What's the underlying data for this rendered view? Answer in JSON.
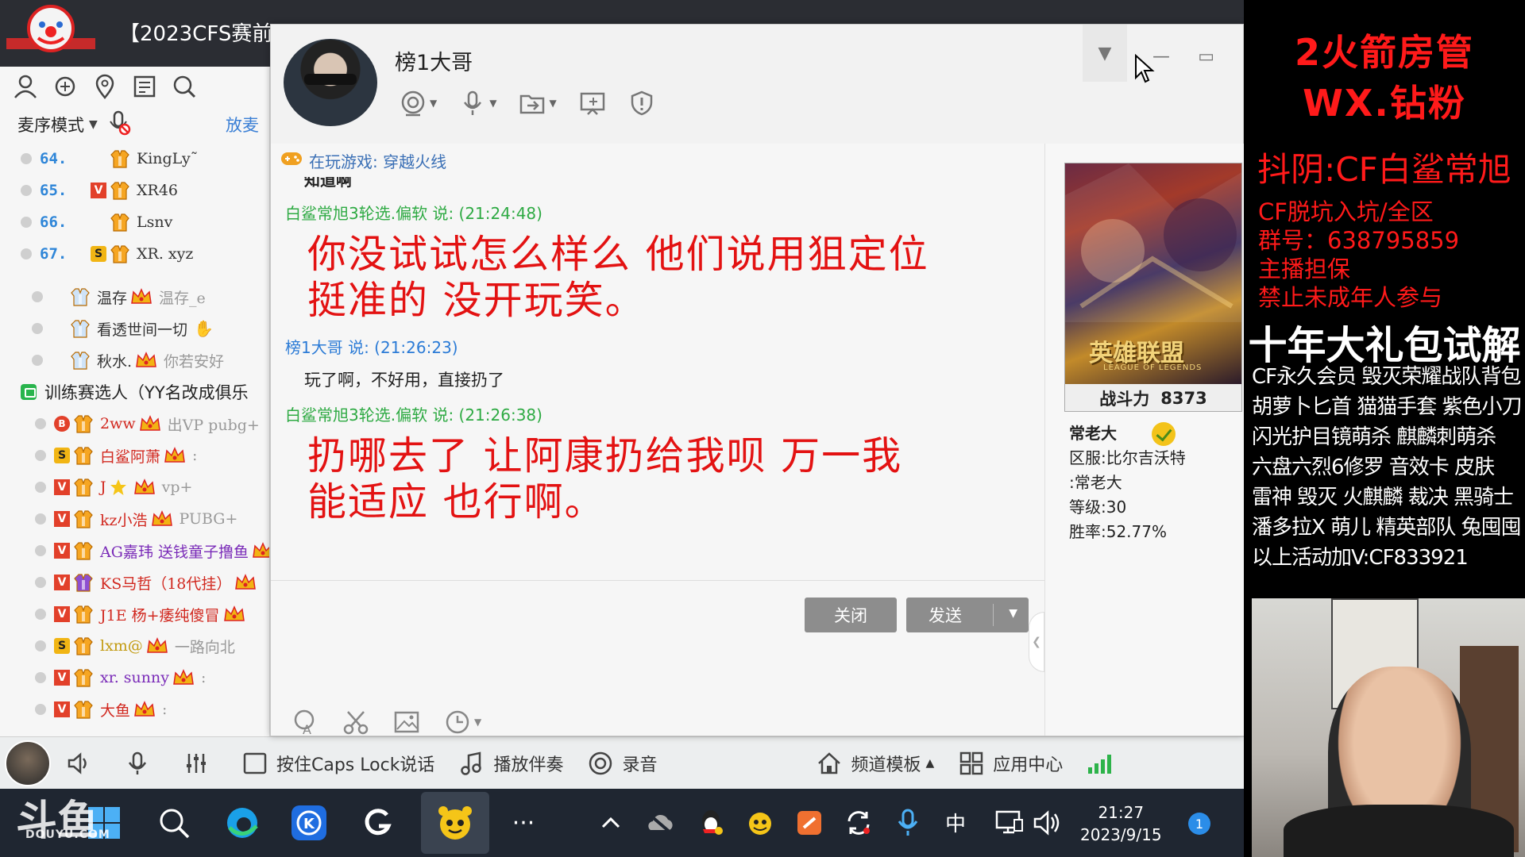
{
  "yy": {
    "channel_title": "【2023CFS赛前",
    "mode_label": "麦序模式",
    "mode_link": "放麦",
    "rank_rows": [
      {
        "num": "64.",
        "name": "KingLy˜"
      },
      {
        "num": "65.",
        "name": "XR46"
      },
      {
        "num": "66.",
        "name": "Lsnⅴ"
      },
      {
        "num": "67.",
        "name": "XR. xyz"
      }
    ],
    "members_a": [
      {
        "name": "温存",
        "sig": "温存_e"
      },
      {
        "name": "看透世间一切",
        "sig": ""
      },
      {
        "name": "秋水.",
        "sig": "你若安好"
      }
    ],
    "group_label": "训练赛选人（YY名改成俱乐",
    "members_b": [
      {
        "name": "2ww",
        "sig": "出VP pubg+"
      },
      {
        "name": "白鲨阿萧",
        "sig": ":"
      },
      {
        "name": "J",
        "sig": "vp+"
      },
      {
        "name": "kz小浩",
        "sig": "PUBG+"
      },
      {
        "name": "AG嘉玮  送钱童子撸鱼",
        "sig": ""
      },
      {
        "name": "KS马哲（18代挂）",
        "sig": ""
      },
      {
        "name": "J1E  杨+痿纯傻冒",
        "sig": ""
      },
      {
        "name": "lxm@",
        "sig": "一路向北"
      },
      {
        "name": "xr. sunny",
        "sig": ":"
      },
      {
        "name": "大鱼",
        "sig": ":"
      }
    ],
    "bottom": {
      "ptt_label": "按住Caps Lock说话",
      "accomp_label": "播放伴奏",
      "record_label": "录音",
      "template_label": "频道模板",
      "app_center_label": "应用中心"
    }
  },
  "chat": {
    "contact_name": "榜1大哥",
    "game_status": "在玩游戏: 穿越火线",
    "clipped_text": "知道啊",
    "messages": [
      {
        "head": "白鲨常旭3轮选.偏软 说: (21:24:48)",
        "lines": [
          "你没试试怎么样么  他们说用狙定位",
          "挺准的  没开玩笑。"
        ]
      },
      {
        "head": "榜1大哥 说: (21:26:23)",
        "text": "玩了啊，不好用，直接扔了"
      },
      {
        "head": "白鲨常旭3轮选.偏软 说: (21:26:38)",
        "lines": [
          "扔哪去了  让阿康扔给我呗  万一我",
          "能适应  也行啊。"
        ]
      }
    ],
    "close_label": "关闭",
    "send_label": "发送",
    "side": {
      "game_logo": "英雄联盟",
      "game_logo_sub": "LEAGUE OF LEGENDS",
      "power_label": "战斗力",
      "power_value": "8373",
      "nickname": "常老大",
      "server": "区服:比尔吉沃特",
      "role": ":常老大",
      "level": "等级:30",
      "winrate": "胜率:52.77%"
    }
  },
  "overlay": {
    "l1": "2火箭房管",
    "l2": "WX.钻粉",
    "l3": "抖阴:CF白鲨常旭",
    "l4": "CF脱坑入坑/全区",
    "l5": "群号：638795859",
    "l6": "主播担保",
    "l7": "禁止未成年人参与",
    "l8": "十年大礼包试解",
    "l9": "CF永久会员 毁灭荣耀战队背包",
    "l10": "胡萝卜匕首 猫猫手套 紫色小刀",
    "l11": "闪光护目镜萌杀 麒麟刺萌杀",
    "l12": "六盘六烈6修罗 音效卡 皮肤",
    "l13": "雷神 毁灭 火麒麟 裁决 黑骑士",
    "l14": "潘多拉X 萌儿 精英部队 兔囤囤",
    "l15": "以上活动加V:CF833921"
  },
  "taskbar": {
    "time": "21:27",
    "date": "2023/9/15",
    "ime": "中",
    "notif_count": "1"
  },
  "watermark": {
    "main": "斗鱼",
    "sub": "DOUYU.COM"
  },
  "colors": {
    "accent_red": "#ff1a1a",
    "chat_red": "#e31212",
    "sender_green": "#2eaa43",
    "sender_blue": "#2b7bd6"
  }
}
